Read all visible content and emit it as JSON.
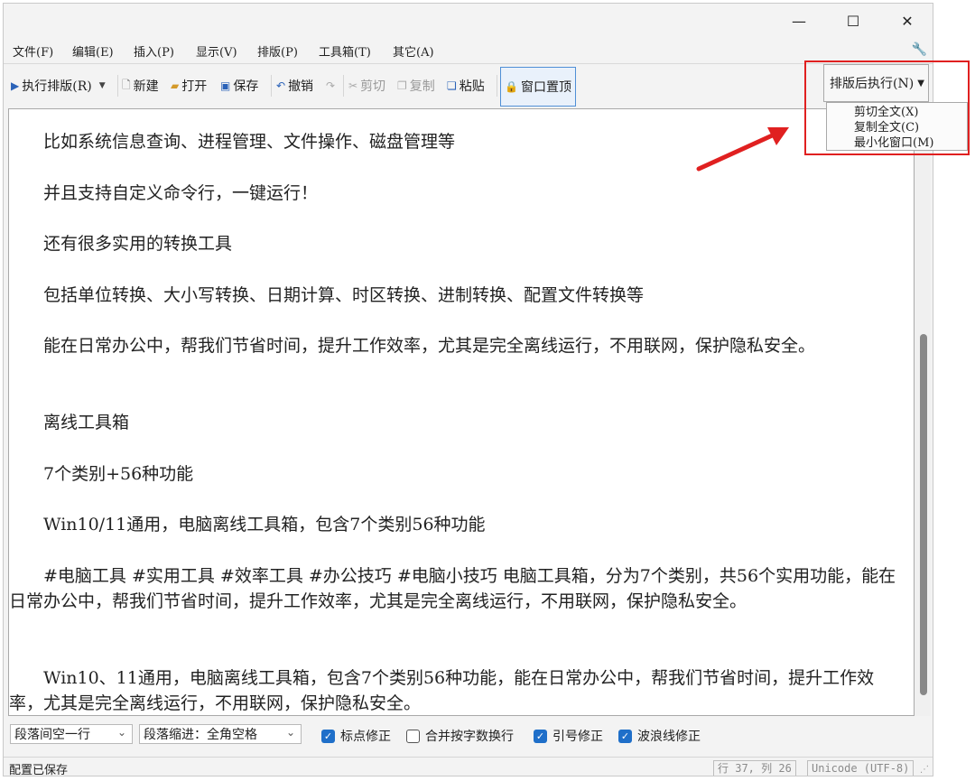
{
  "window": {
    "minimize": "—",
    "maximize": "☐",
    "close": "✕"
  },
  "menubar": {
    "items": [
      "文件(F)",
      "编辑(E)",
      "插入(P)",
      "显示(V)",
      "排版(P)",
      "工具箱(T)",
      "其它(A)"
    ],
    "wrench_icon": "wrench-icon"
  },
  "toolbar": {
    "run_format": "执行排版(R)",
    "new": "新建",
    "open": "打开",
    "save": "保存",
    "undo": "撤销",
    "cut": "剪切",
    "copy": "复制",
    "paste": "粘贴",
    "pin_window": "窗口置顶",
    "after_format": "排版后执行(N)"
  },
  "after_format_menu": {
    "items": [
      "剪切全文(X)",
      "复制全文(C)",
      "最小化窗口(M)"
    ]
  },
  "editor": {
    "paragraphs": [
      "　　比如系统信息查询、进程管理、文件操作、磁盘管理等",
      "　　并且支持自定义命令行，一键运行！",
      "　　还有很多实用的转换工具",
      "　　包括单位转换、大小写转换、日期计算、时区转换、进制转换、配置文件转换等",
      "　　能在日常办公中，帮我们节省时间，提升工作效率，尤其是完全离线运行，不用联网，保护隐私安全。",
      "　　离线工具箱",
      "　　7个类别+56种功能",
      "　　Win10/11通用，电脑离线工具箱，包含7个类别56种功能",
      "　　#电脑工具 #实用工具 #效率工具 #办公技巧 #电脑小技巧 电脑工具箱，分为7个类别，共56个实用功能，能在日常办公中，帮我们节省时间，提升工作效率，尤其是完全离线运行，不用联网，保护隐私安全。",
      "　　Win10、11通用，电脑离线工具箱，包含7个类别56种功能，能在日常办公中，帮我们节省时间，提升工作效率，尤其是完全离线运行，不用联网，保护隐私安全。"
    ]
  },
  "options": {
    "para_spacing": "段落间空一行",
    "para_indent": "段落缩进：全角空格",
    "checks": [
      {
        "label": "标点修正",
        "checked": true
      },
      {
        "label": "合并按字数换行",
        "checked": false
      },
      {
        "label": "引号修正",
        "checked": true
      },
      {
        "label": "波浪线修正",
        "checked": true
      }
    ]
  },
  "status": {
    "message": "配置已保存",
    "position": "行 37, 列 26",
    "encoding": "Unicode (UTF-8)"
  },
  "colors": {
    "highlight": "#e02020",
    "accent": "#1f6fc9"
  }
}
